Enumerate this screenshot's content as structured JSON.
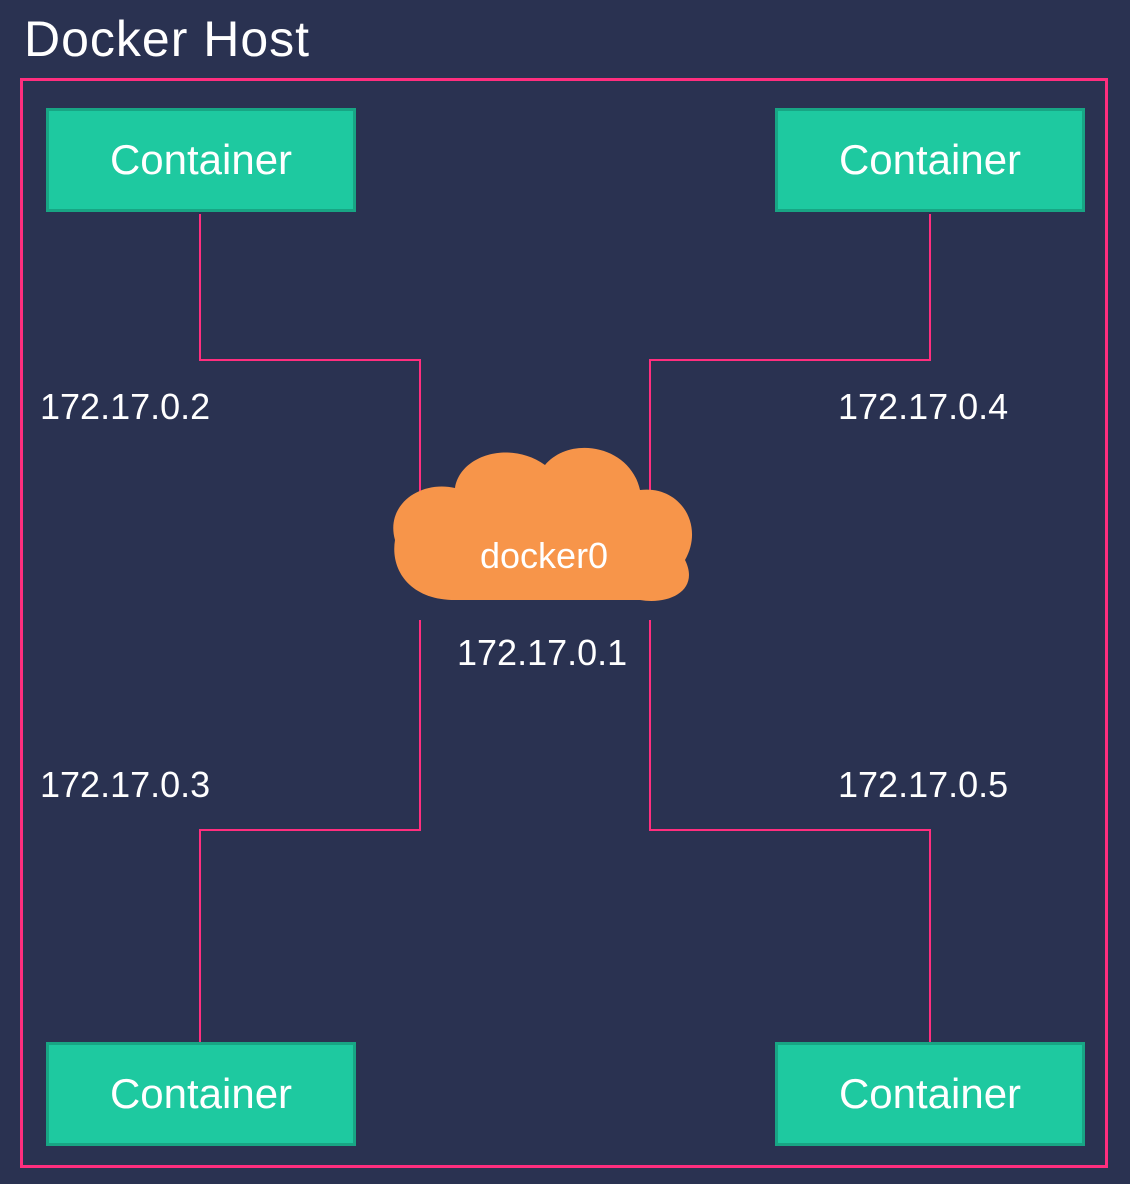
{
  "title": "Docker Host",
  "bridge": {
    "name": "docker0",
    "ip": "172.17.0.1"
  },
  "containers": [
    {
      "label": "Container",
      "ip": "172.17.0.2"
    },
    {
      "label": "Container",
      "ip": "172.17.0.4"
    },
    {
      "label": "Container",
      "ip": "172.17.0.3"
    },
    {
      "label": "Container",
      "ip": "172.17.0.5"
    }
  ],
  "colors": {
    "background": "#2a3251",
    "border": "#ff2e7e",
    "container_fill": "#1ec9a0",
    "container_border": "#18a584",
    "cloud": "#f7954a",
    "text": "#ffffff"
  }
}
